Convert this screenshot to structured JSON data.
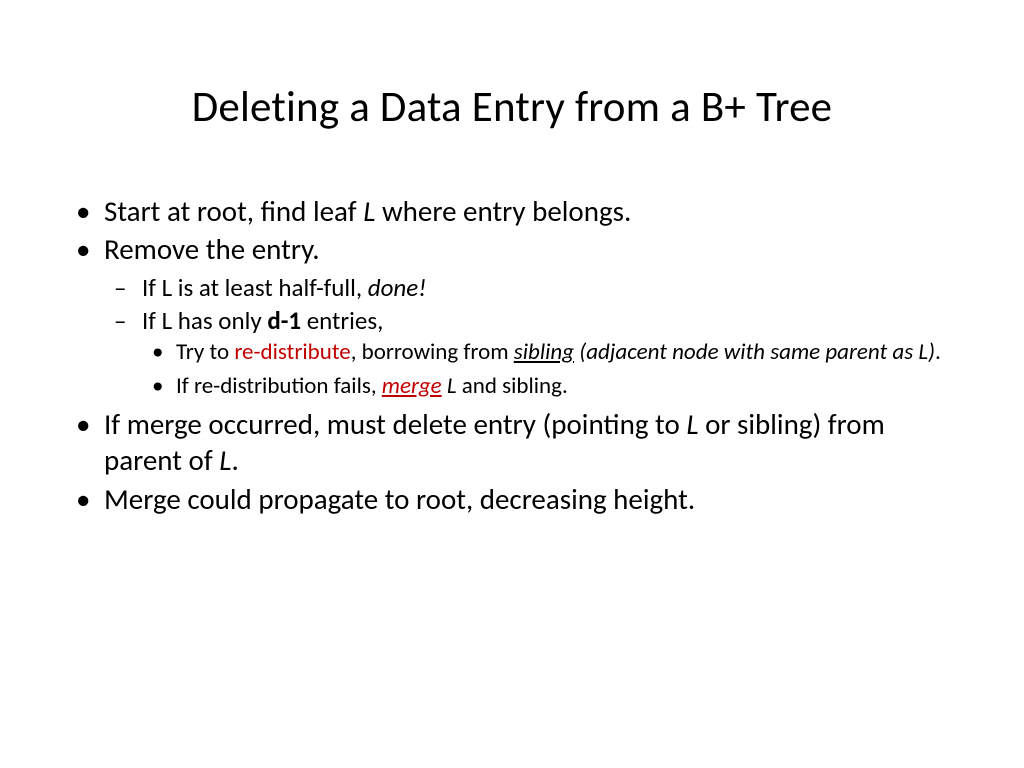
{
  "title": "Deleting a Data Entry from a B+ Tree",
  "bullets": {
    "b1_a": "Start at root, find leaf ",
    "b1_L": "L",
    "b1_b": " where entry belongs.",
    "b2": "Remove the entry.",
    "b2_1_a": "If L is at least half-full, ",
    "b2_1_done": "done!",
    "b2_2_a": "If L has only ",
    "b2_2_d1": "d-1",
    "b2_2_b": " entries,",
    "b2_2_1_a": "Try to ",
    "b2_2_1_redist": "re-distribute",
    "b2_2_1_b": ", borrowing from ",
    "b2_2_1_sib": "sibling",
    "b2_2_1_c": " (adjacent node with same parent as L)",
    "b2_2_1_d": ".",
    "b2_2_2_a": "If re-distribution fails, ",
    "b2_2_2_merge": "merge",
    "b2_2_2_sp": " ",
    "b2_2_2_L": "L",
    "b2_2_2_b": " and sibling.",
    "b3_a": "If merge occurred, must delete entry (pointing to ",
    "b3_L1": "L",
    "b3_b": " or sibling) from parent of ",
    "b3_L2": "L",
    "b3_c": ".",
    "b4": "Merge could propagate to root, decreasing height."
  }
}
